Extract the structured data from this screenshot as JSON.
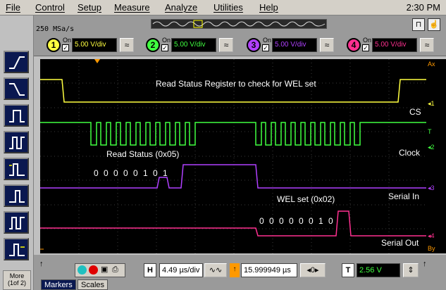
{
  "menu": {
    "items": [
      "File",
      "Control",
      "Setup",
      "Measure",
      "Analyze",
      "Utilities",
      "Help"
    ],
    "clock": "2:30 PM"
  },
  "header": {
    "sample_rate": "250 MSa/s"
  },
  "channels": [
    {
      "num": "1",
      "on": "On",
      "scale": "5.00 V/div",
      "color": "#ffff40"
    },
    {
      "num": "2",
      "on": "On",
      "scale": "5.00 V/div",
      "color": "#40ff40"
    },
    {
      "num": "3",
      "on": "On",
      "scale": "5.00 V/div",
      "color": "#b040ff"
    },
    {
      "num": "4",
      "on": "On",
      "scale": "5.00 V/div",
      "color": "#ff3090"
    }
  ],
  "scope": {
    "title": "Read Status Register to check for WEL set",
    "cs_label": "CS",
    "clock_label": "Clock",
    "read_status": "Read Status (0x05)",
    "serial_in_bits": "0 0 0 0 0 1 0 1",
    "serial_in_label": "Serial In",
    "wel_set": "WEL set (0x02)",
    "serial_out_bits": "0 0 0 0 0 0 1 0",
    "serial_out_label": "Serial Out"
  },
  "gutter": {
    "t": "T",
    "ax": "Ax",
    "bx": "Bx",
    "ay": "Ay",
    "by": "By"
  },
  "bottom": {
    "more_label": "More (1of 2)",
    "h_label": "H",
    "time_div": "4.49 µs/div",
    "delay": "15.999949 µs",
    "trigger_label": "T",
    "trigger_level": "2.56 V",
    "tabs": [
      "Markers",
      "Scales"
    ]
  }
}
